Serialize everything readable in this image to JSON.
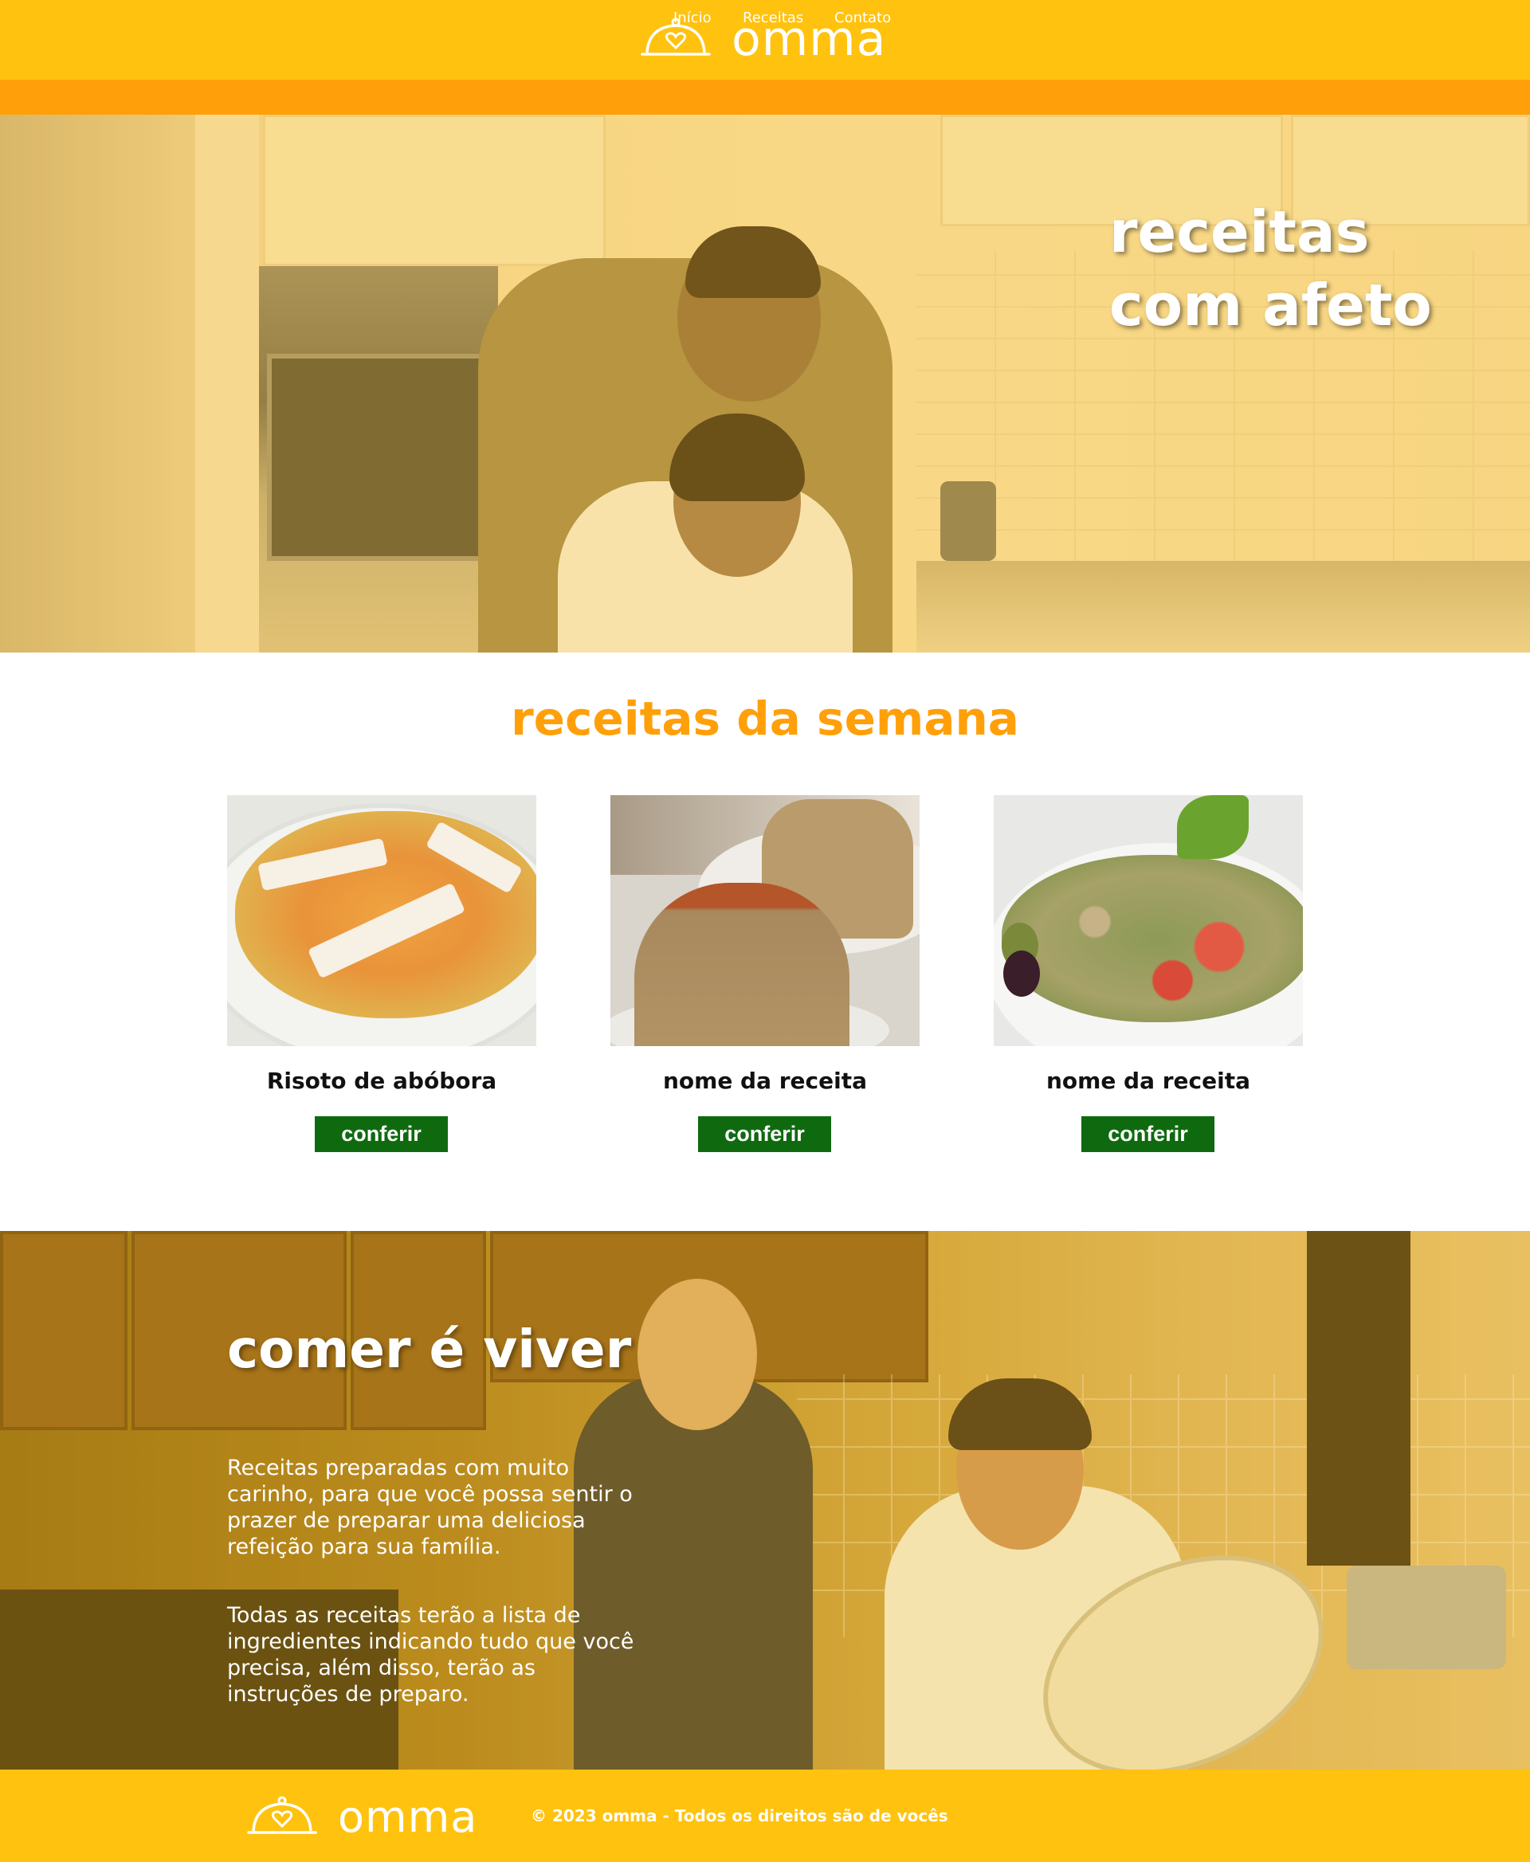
{
  "brand": {
    "name": "omma",
    "icon": "cloche-heart-icon"
  },
  "nav": {
    "items": [
      "Início",
      "Receitas",
      "Contato"
    ]
  },
  "hero": {
    "title_line1": "receitas",
    "title_line2": "com afeto"
  },
  "recipes": {
    "title": "receitas da semana",
    "cards": [
      {
        "name": "Risoto de abóbora",
        "button": "conferir"
      },
      {
        "name": "nome da receita",
        "button": "conferir"
      },
      {
        "name": "nome da receita",
        "button": "conferir"
      }
    ]
  },
  "about": {
    "title": "comer é viver",
    "paragraph1": "Receitas preparadas com muito carinho, para que você possa sentir o prazer de preparar uma deliciosa refeição para sua família.",
    "paragraph2": "Todas as receitas terão a lista de ingredientes indicando tudo que você precisa, além disso, terão as instruções de preparo."
  },
  "footer": {
    "copyright": "© 2023 omma - Todos os direitos são de vocês"
  },
  "colors": {
    "header": "#ffc20e",
    "nav": "#ffa00a",
    "title": "#ffa00a",
    "button": "#0f6a0f"
  }
}
